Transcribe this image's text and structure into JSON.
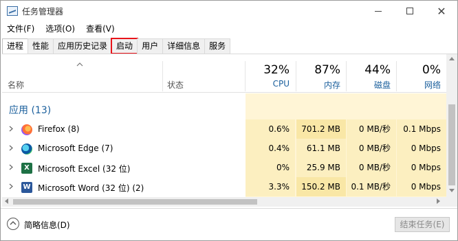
{
  "window": {
    "title": "任务管理器"
  },
  "menu": [
    "文件(F)",
    "选项(O)",
    "查看(V)"
  ],
  "tabs": [
    {
      "label": "进程",
      "active": true
    },
    {
      "label": "性能"
    },
    {
      "label": "应用历史记录"
    },
    {
      "label": "启动",
      "highlighted": true
    },
    {
      "label": "用户"
    },
    {
      "label": "详细信息"
    },
    {
      "label": "服务"
    }
  ],
  "columns": {
    "name": "名称",
    "status": "状态",
    "metrics": [
      {
        "percent": "32%",
        "label": "CPU"
      },
      {
        "percent": "87%",
        "label": "内存"
      },
      {
        "percent": "44%",
        "label": "磁盘"
      },
      {
        "percent": "0%",
        "label": "网络"
      }
    ]
  },
  "group": {
    "title": "应用 (13)"
  },
  "processes": [
    {
      "name": "Firefox (8)",
      "icon": "firefox-icon",
      "cpu": "0.6%",
      "memory": "701.2 MB",
      "disk": "0 MB/秒",
      "network": "0.1 Mbps"
    },
    {
      "name": "Microsoft Edge (7)",
      "icon": "edge-icon",
      "cpu": "0.4%",
      "memory": "61.1 MB",
      "disk": "0 MB/秒",
      "network": "0 Mbps"
    },
    {
      "name": "Microsoft Excel (32 位)",
      "icon": "excel-icon",
      "cpu": "0%",
      "memory": "25.9 MB",
      "disk": "0 MB/秒",
      "network": "0 Mbps"
    },
    {
      "name": "Microsoft Word (32 位) (2)",
      "icon": "word-icon",
      "cpu": "3.3%",
      "memory": "150.2 MB",
      "disk": "0.1 MB/秒",
      "network": "0 Mbps"
    }
  ],
  "footer": {
    "details_label": "简略信息(D)",
    "end_task_label": "结束任务(E)"
  },
  "colors": {
    "accent_blue": "#1a5f9c",
    "heat_light": "#fff5d6",
    "heat_mid": "#fcefc0",
    "heat_high": "#f9e7a6",
    "highlight_box": "#e8141a"
  }
}
